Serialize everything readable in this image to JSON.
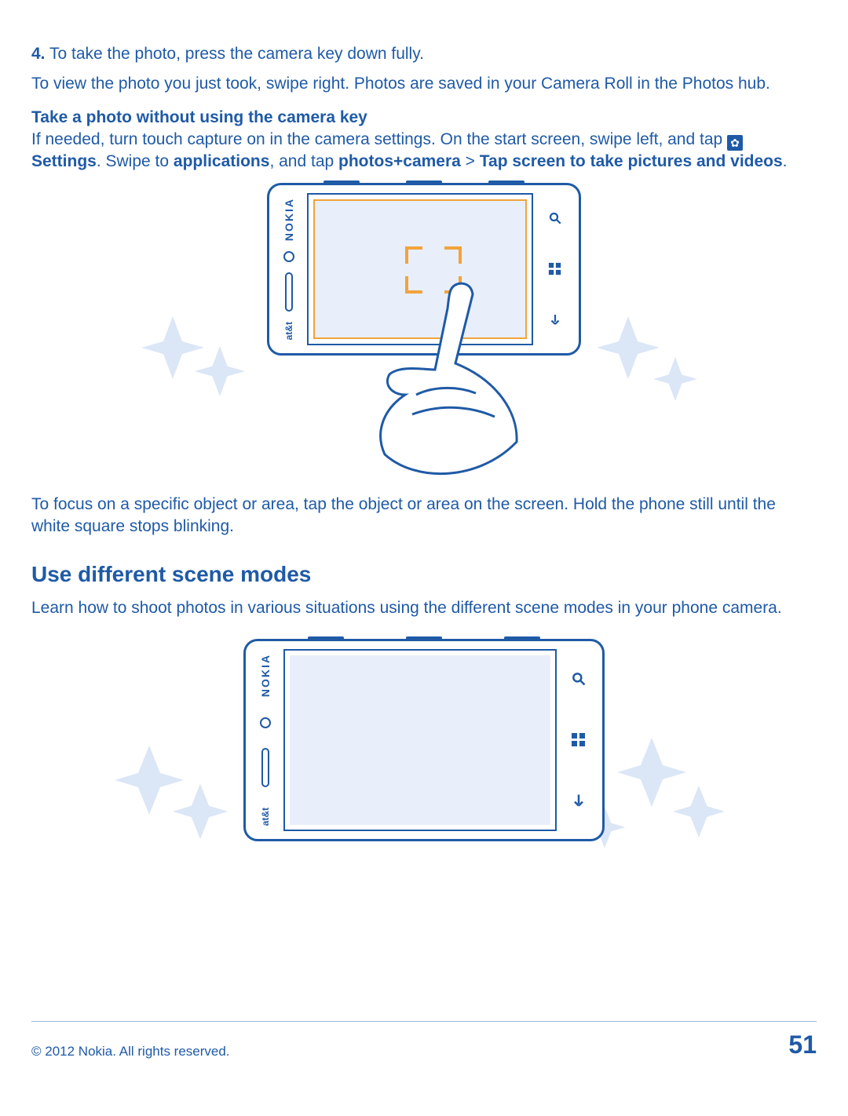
{
  "step4": {
    "num": "4.",
    "text": " To take the photo, press the camera key down fully."
  },
  "para_view": "To view the photo you just took, swipe right. Photos are saved in your Camera Roll in the Photos hub.",
  "sub1_title": "Take a photo without using the camera key",
  "sub1_lead": "If needed, turn touch capture on in the camera settings. On the start screen, swipe left, and tap ",
  "settings_icon_name": "settings-gear-icon",
  "settings_label": "Settings",
  "path_text1": ". Swipe to ",
  "path_bold1": "applications",
  "path_text2": ", and tap ",
  "path_bold2": "photos+camera",
  "path_sep": " > ",
  "path_bold3": "Tap screen to take pictures and videos",
  "path_end": ".",
  "para_focus": "To focus on a specific object or area, tap the object or area on the screen. Hold the phone still until the white square stops blinking.",
  "section2_title": "Use different scene modes",
  "section2_para": "Learn how to shoot photos in various situations using the different scene modes in your phone camera.",
  "phone": {
    "brand": "NOKIA",
    "carrier": "at&t",
    "softkeys": {
      "search": "search-icon",
      "start": "windows-start-icon",
      "back": "back-arrow-icon"
    }
  },
  "footer": {
    "copyright": "© 2012 Nokia. All rights reserved.",
    "page": "51"
  },
  "colors": {
    "primary": "#1f5aa6",
    "accent": "#f2a33c",
    "paleblue": "#b9cdea",
    "midblue": "#6f93c8",
    "screenbg": "#e8effa"
  }
}
